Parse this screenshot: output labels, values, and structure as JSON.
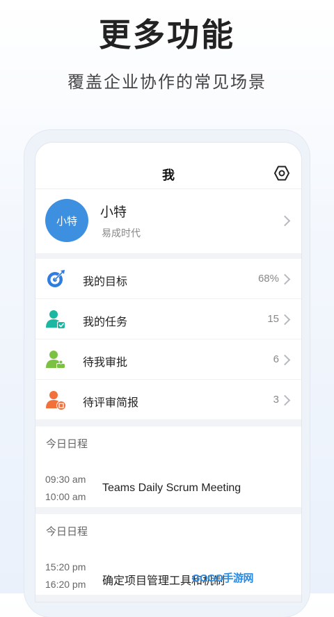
{
  "promo": {
    "headline": "更多功能",
    "subline": "覆盖企业协作的常见场景"
  },
  "navbar": {
    "title": "我",
    "settings_icon": "hexagon-settings-icon"
  },
  "profile": {
    "avatar_text": "小特",
    "avatar_color": "#3d8fe0",
    "name": "小特",
    "organization": "易成时代"
  },
  "menu": [
    {
      "label": "我的目标",
      "value": "68%",
      "icon": "target-icon",
      "color": "#2f7de0"
    },
    {
      "label": "我的任务",
      "value": "15",
      "icon": "task-user-icon",
      "color": "#1bb7a0"
    },
    {
      "label": "待我审批",
      "value": "6",
      "icon": "approval-user-icon",
      "color": "#7cc242"
    },
    {
      "label": "待评审简报",
      "value": "3",
      "icon": "report-user-icon",
      "color": "#f2703a"
    }
  ],
  "schedules": [
    {
      "header": "今日日程",
      "start": "09:30 am",
      "end": "10:00 am",
      "title": "Teams Daily Scrum Meeting"
    },
    {
      "header": "今日日程",
      "start": "15:20 pm",
      "end": "16:20 pm",
      "title": "确定项目管理工具和机制"
    }
  ],
  "watermark": "GOGO手游网"
}
